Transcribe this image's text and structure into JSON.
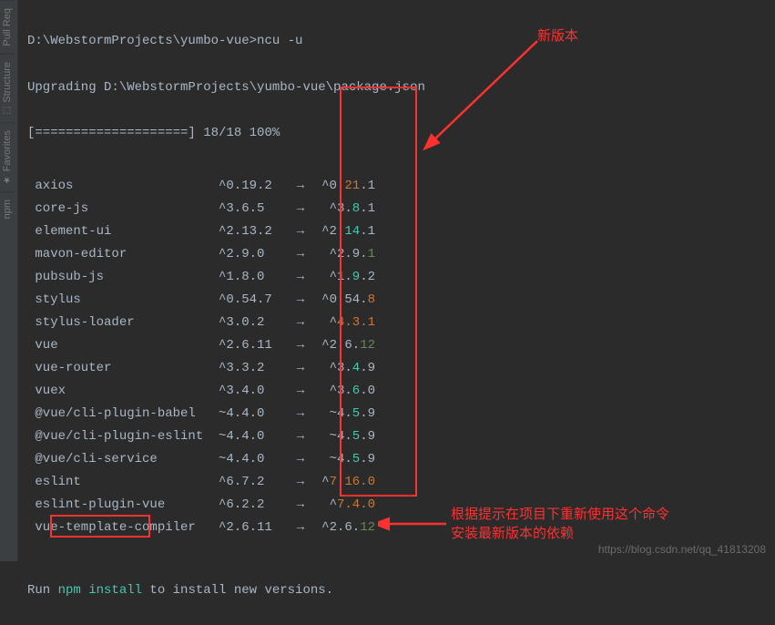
{
  "sidebar": {
    "items": [
      {
        "label": "Pull Req"
      },
      {
        "label": "Structure"
      },
      {
        "label": "Favorites"
      },
      {
        "label": "npm"
      }
    ]
  },
  "terminal": {
    "prompt": "D:\\WebstormProjects\\yumbo-vue>ncu -u",
    "upgrading": "Upgrading D:\\WebstormProjects\\yumbo-vue\\package.json",
    "progress": "[====================] 18/18 100%",
    "run_prefix": "Run ",
    "run_cmd": "npm install",
    "run_suffix": " to install new versions."
  },
  "packages": [
    {
      "name": "axios",
      "old": "^0.19.2",
      "newPrefix": "^0.",
      "newMajor": "21",
      "newMinor": ".1",
      "majorColor": "c-red",
      "minorColor": ""
    },
    {
      "name": "core-js",
      "old": "^3.6.5",
      "newPrefix": "^3.",
      "newMajor": "8",
      "newMinor": ".1",
      "majorColor": "c-cyan",
      "minorColor": ""
    },
    {
      "name": "element-ui",
      "old": "^2.13.2",
      "newPrefix": "^2.",
      "newMajor": "14",
      "newMinor": ".1",
      "majorColor": "c-cyan",
      "minorColor": ""
    },
    {
      "name": "mavon-editor",
      "old": "^2.9.0",
      "newPrefix": "^2.9.",
      "newMajor": "",
      "newMinor": "1",
      "majorColor": "",
      "minorColor": "c-green"
    },
    {
      "name": "pubsub-js",
      "old": "^1.8.0",
      "newPrefix": "^1.",
      "newMajor": "9",
      "newMinor": ".2",
      "majorColor": "c-cyan",
      "minorColor": ""
    },
    {
      "name": "stylus",
      "old": "^0.54.7",
      "newPrefix": "^0.54.",
      "newMajor": "",
      "newMinor": "8",
      "majorColor": "",
      "minorColor": "c-red"
    },
    {
      "name": "stylus-loader",
      "old": "^3.0.2",
      "newPrefix": "^",
      "newMajor": "4.3.1",
      "newMinor": "",
      "majorColor": "c-red",
      "minorColor": ""
    },
    {
      "name": "vue",
      "old": "^2.6.11",
      "newPrefix": "^2.6.",
      "newMajor": "",
      "newMinor": "12",
      "majorColor": "",
      "minorColor": "c-green"
    },
    {
      "name": "vue-router",
      "old": "^3.3.2",
      "newPrefix": "^3.",
      "newMajor": "4",
      "newMinor": ".9",
      "majorColor": "c-cyan",
      "minorColor": ""
    },
    {
      "name": "vuex",
      "old": "^3.4.0",
      "newPrefix": "^3.",
      "newMajor": "6",
      "newMinor": ".0",
      "majorColor": "c-cyan",
      "minorColor": ""
    },
    {
      "name": "@vue/cli-plugin-babel",
      "old": "~4.4.0",
      "newPrefix": "~4.",
      "newMajor": "5",
      "newMinor": ".9",
      "majorColor": "c-cyan",
      "minorColor": ""
    },
    {
      "name": "@vue/cli-plugin-eslint",
      "old": "~4.4.0",
      "newPrefix": "~4.",
      "newMajor": "5",
      "newMinor": ".9",
      "majorColor": "c-cyan",
      "minorColor": ""
    },
    {
      "name": "@vue/cli-service",
      "old": "~4.4.0",
      "newPrefix": "~4.",
      "newMajor": "5",
      "newMinor": ".9",
      "majorColor": "c-cyan",
      "minorColor": ""
    },
    {
      "name": "eslint",
      "old": "^6.7.2",
      "newPrefix": "^",
      "newMajor": "7.16.0",
      "newMinor": "",
      "majorColor": "c-red",
      "minorColor": ""
    },
    {
      "name": "eslint-plugin-vue",
      "old": "^6.2.2",
      "newPrefix": "^",
      "newMajor": "7.4.0",
      "newMinor": "",
      "majorColor": "c-red",
      "minorColor": ""
    },
    {
      "name": "vue-template-compiler",
      "old": "^2.6.11",
      "newPrefix": "^2.6.",
      "newMajor": "",
      "newMinor": "12",
      "majorColor": "",
      "minorColor": "c-green"
    }
  ],
  "annotations": {
    "new_version": "新版本",
    "hint_line1": "根据提示在项目下重新使用这个命令",
    "hint_line2": "安装最新版本的依赖"
  },
  "watermark": "https://blog.csdn.net/qq_41813208"
}
